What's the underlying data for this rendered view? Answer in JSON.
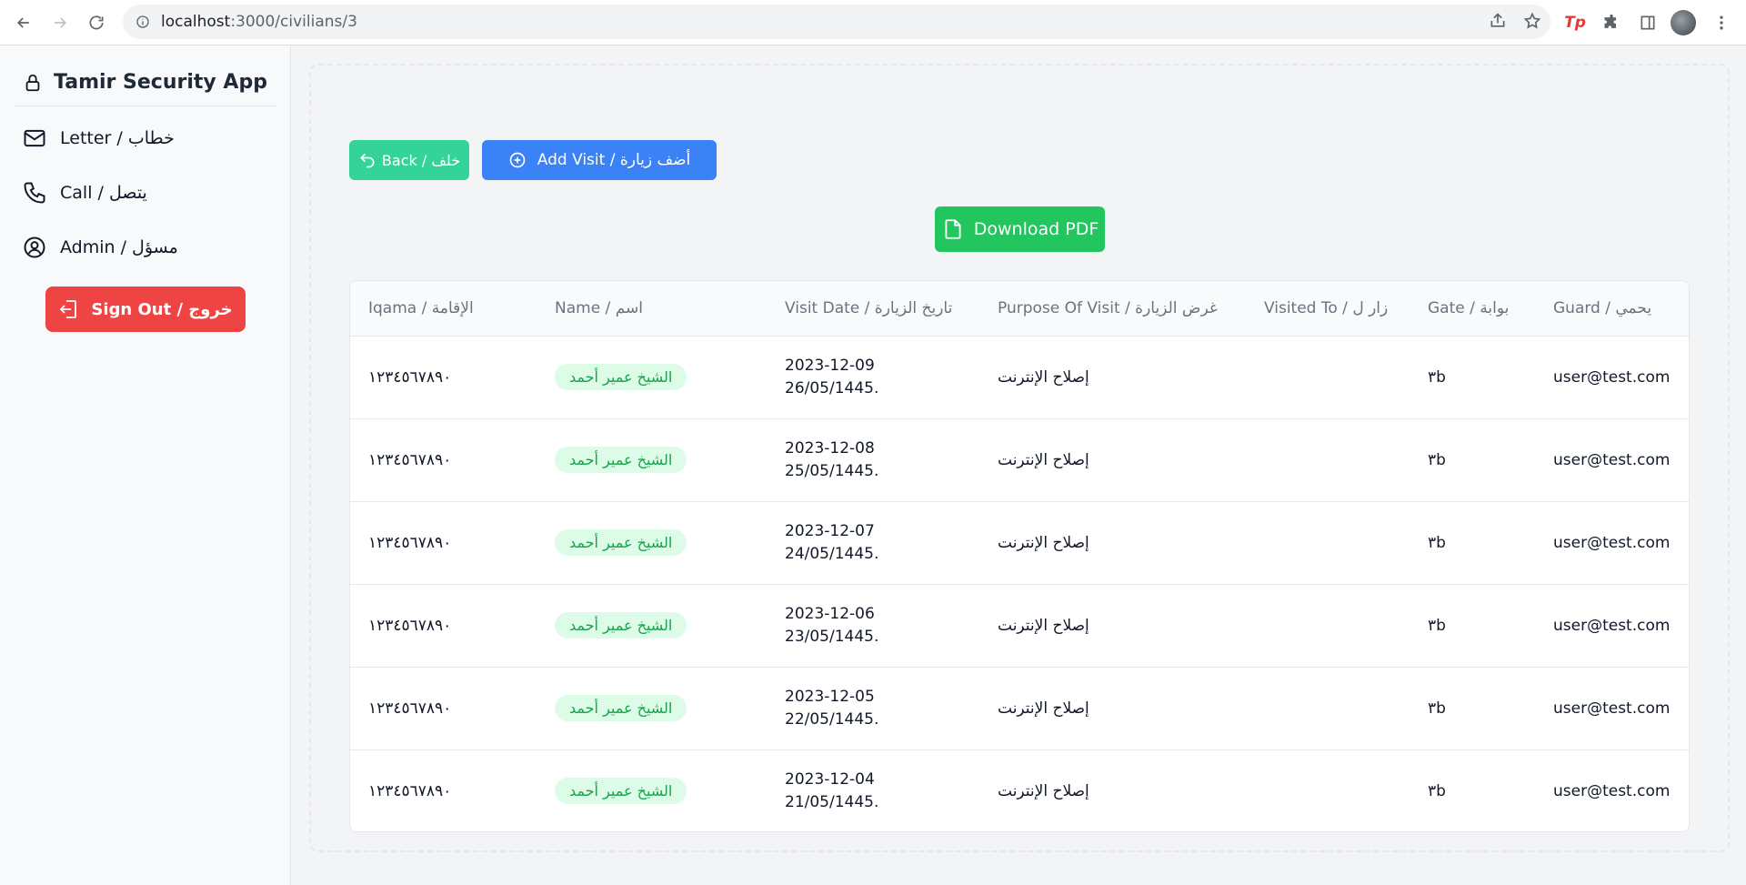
{
  "browser": {
    "url_host": "localhost",
    "url_path": ":3000/civilians/3"
  },
  "sidebar": {
    "app_title": "Tamir Security App",
    "items": [
      {
        "label": "Letter / خطاب",
        "icon": "mail-icon"
      },
      {
        "label": "Call / يتصل",
        "icon": "phone-icon"
      },
      {
        "label": "Admin / مسؤل",
        "icon": "user-circle-icon"
      }
    ],
    "signout_label": "Sign Out / خروج"
  },
  "actions": {
    "back_label": "Back / خلف",
    "add_visit_label": "Add Visit / أضف زيارة",
    "download_pdf_label": "Download PDF"
  },
  "table": {
    "headers": {
      "iqama": "Iqama / الإقامة",
      "name": "Name / اسم",
      "visit_date": "Visit Date / تاريخ الزيارة",
      "purpose": "Purpose Of Visit / غرض الزيارة",
      "visited_to": "Visited To / زار ل",
      "gate": "Gate / بوابة",
      "guard": "Guard / يحمي"
    },
    "rows": [
      {
        "iqama": "١٢٣٤٥٦٧٨٩٠",
        "name": "الشيخ عمير أحمد",
        "date": "2023-12-09",
        "hijri": "26/05/1445.",
        "purpose": "إصلاح الإنترنت",
        "visited_to": "",
        "gate": "٣b",
        "guard": "user@test.com"
      },
      {
        "iqama": "١٢٣٤٥٦٧٨٩٠",
        "name": "الشيخ عمير أحمد",
        "date": "2023-12-08",
        "hijri": "25/05/1445.",
        "purpose": "إصلاح الإنترنت",
        "visited_to": "",
        "gate": "٣b",
        "guard": "user@test.com"
      },
      {
        "iqama": "١٢٣٤٥٦٧٨٩٠",
        "name": "الشيخ عمير أحمد",
        "date": "2023-12-07",
        "hijri": "24/05/1445.",
        "purpose": "إصلاح الإنترنت",
        "visited_to": "",
        "gate": "٣b",
        "guard": "user@test.com"
      },
      {
        "iqama": "١٢٣٤٥٦٧٨٩٠",
        "name": "الشيخ عمير أحمد",
        "date": "2023-12-06",
        "hijri": "23/05/1445.",
        "purpose": "إصلاح الإنترنت",
        "visited_to": "",
        "gate": "٣b",
        "guard": "user@test.com"
      },
      {
        "iqama": "١٢٣٤٥٦٧٨٩٠",
        "name": "الشيخ عمير أحمد",
        "date": "2023-12-05",
        "hijri": "22/05/1445.",
        "purpose": "إصلاح الإنترنت",
        "visited_to": "",
        "gate": "٣b",
        "guard": "user@test.com"
      },
      {
        "iqama": "١٢٣٤٥٦٧٨٩٠",
        "name": "الشيخ عمير أحمد",
        "date": "2023-12-04",
        "hijri": "21/05/1445.",
        "purpose": "إصلاح الإنترنت",
        "visited_to": "",
        "gate": "٣b",
        "guard": "user@test.com"
      }
    ]
  }
}
